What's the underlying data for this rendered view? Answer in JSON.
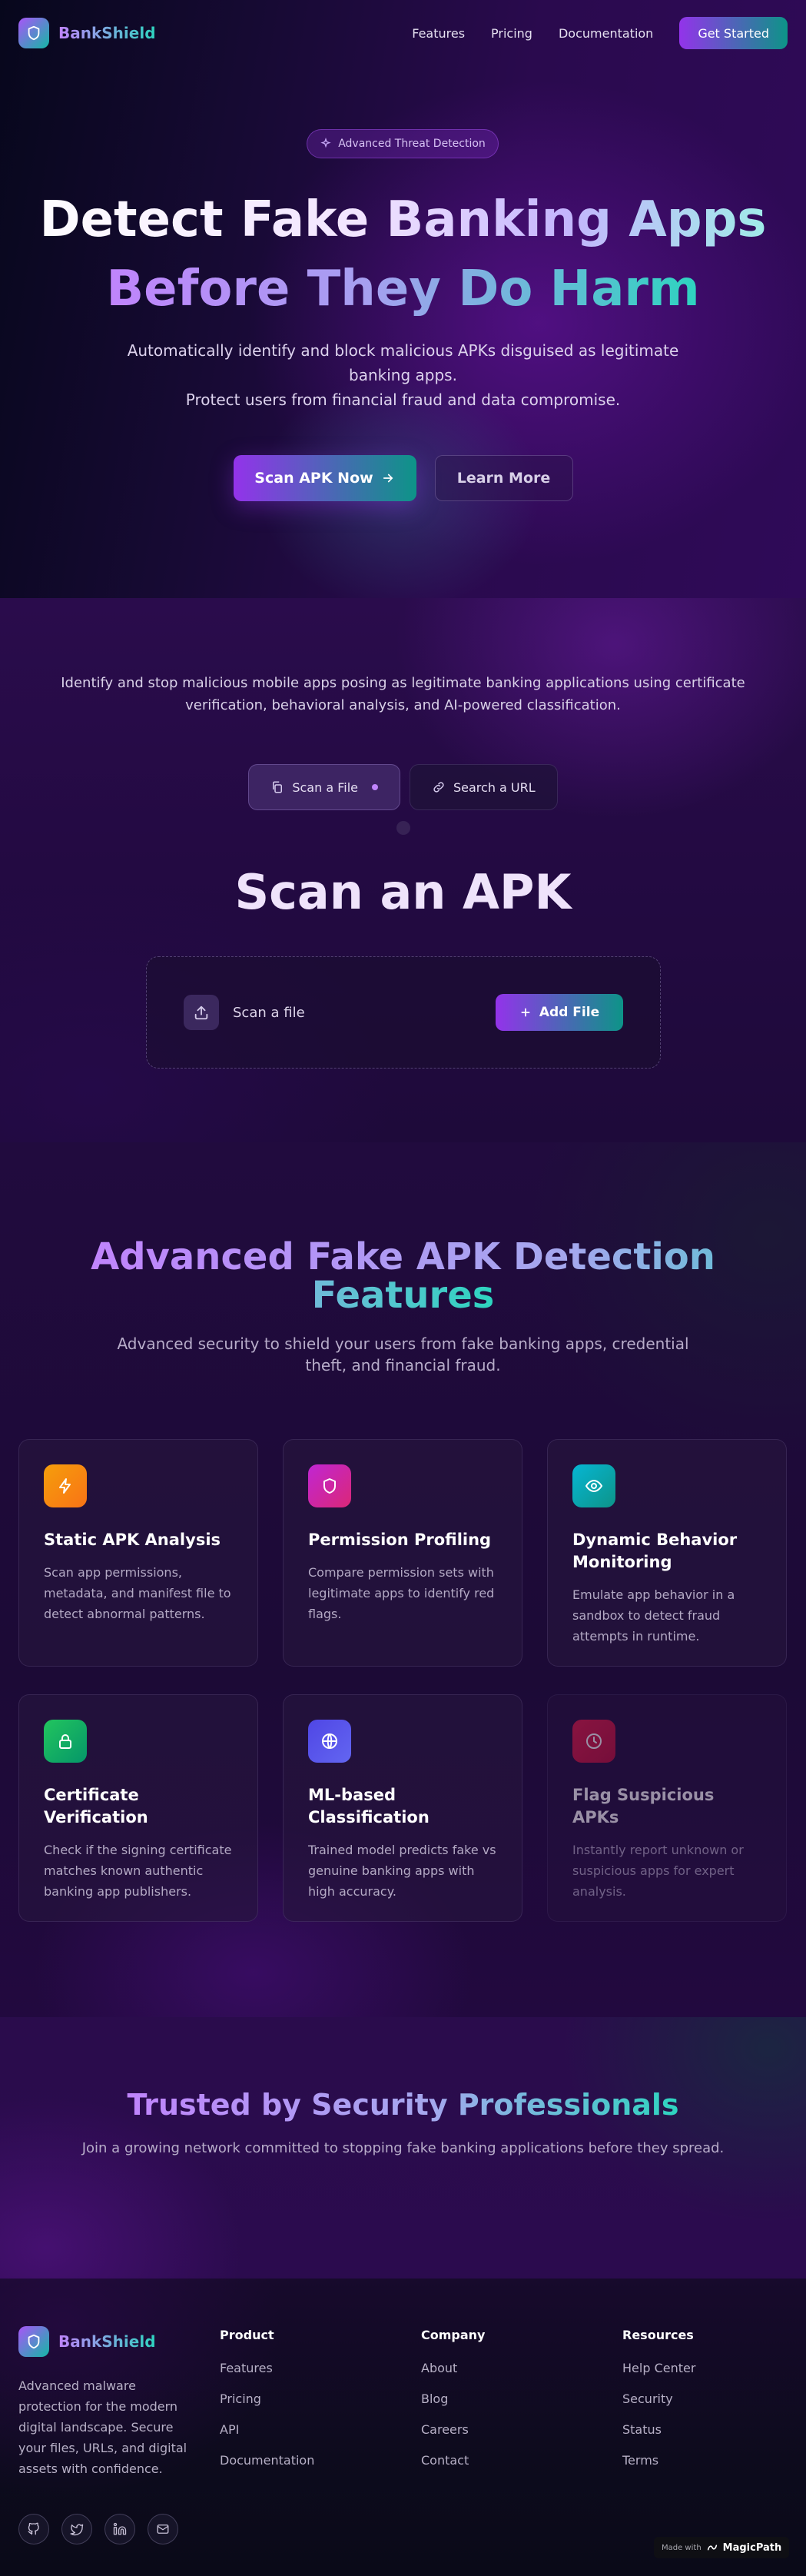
{
  "nav": {
    "brand": "BankShield",
    "links": [
      "Features",
      "Pricing",
      "Documentation"
    ],
    "cta": "Get Started"
  },
  "hero": {
    "badge": "Advanced Threat Detection",
    "title_line1": "Detect Fake Banking Apps",
    "title_line2": "Before They Do Harm",
    "subtitle_line1": "Automatically identify and block malicious APKs disguised as legitimate banking apps.",
    "subtitle_line2": "Protect users from financial fraud and data compromise.",
    "primary_button": "Scan APK Now",
    "secondary_button": "Learn More"
  },
  "scan": {
    "intro": "Identify and stop malicious mobile apps posing as legitimate banking applications using certificate verification, behavioral analysis, and AI-powered classification.",
    "tabs": [
      {
        "label": "Scan a File",
        "icon": "file-copy-icon",
        "active": true
      },
      {
        "label": "Search a URL",
        "icon": "link-icon",
        "active": false
      }
    ],
    "heading": "Scan an APK",
    "drop_label": "Scan a file",
    "add_button": "Add File"
  },
  "features": {
    "title": "Advanced Fake APK Detection Features",
    "subtitle": "Advanced security to shield your users from fake banking apps, credential theft, and financial fraud.",
    "items": [
      {
        "title": "Static APK Analysis",
        "desc": "Scan app permissions, metadata, and manifest file to detect abnormal patterns.",
        "icon": "lightning-icon",
        "color": "#f97316"
      },
      {
        "title": "Permission Profiling",
        "desc": "Compare permission sets with legitimate apps to identify red flags.",
        "icon": "shield-icon",
        "color": "#c026d3"
      },
      {
        "title": "Dynamic Behavior Monitoring",
        "desc": "Emulate app behavior in a sandbox to detect fraud attempts in runtime.",
        "icon": "eye-icon",
        "color": "#0891b2"
      },
      {
        "title": "Certificate Verification",
        "desc": "Check if the signing certificate matches known authentic banking app publishers.",
        "icon": "lock-icon",
        "color": "#16a34a"
      },
      {
        "title": "ML-based Classification",
        "desc": "Trained model predicts fake vs genuine banking apps with high accuracy.",
        "icon": "globe-icon",
        "color": "#4f46e5"
      },
      {
        "title": "Flag Suspicious APKs",
        "desc": "Instantly report unknown or suspicious apps for expert analysis.",
        "icon": "clock-icon",
        "color": "#e11d48"
      }
    ]
  },
  "trust": {
    "title": "Trusted by Security Professionals",
    "subtitle": "Join a growing network committed to stopping fake banking applications before they spread."
  },
  "footer": {
    "brand": "BankShield",
    "about": "Advanced malware protection for the modern digital landscape. Secure your files, URLs, and digital assets with confidence.",
    "columns": [
      {
        "title": "Product",
        "links": [
          "Features",
          "Pricing",
          "API",
          "Documentation"
        ]
      },
      {
        "title": "Company",
        "links": [
          "About",
          "Blog",
          "Careers",
          "Contact"
        ]
      },
      {
        "title": "Resources",
        "links": [
          "Help Center",
          "Security",
          "Status",
          "Terms"
        ]
      }
    ],
    "socials": [
      "github-icon",
      "twitter-icon",
      "linkedin-icon",
      "mail-icon"
    ],
    "made_with_prefix": "Made with",
    "made_with_brand": "MagicPath"
  },
  "colors": {
    "accent_purple": "#9333ea",
    "accent_teal": "#0d9488"
  }
}
